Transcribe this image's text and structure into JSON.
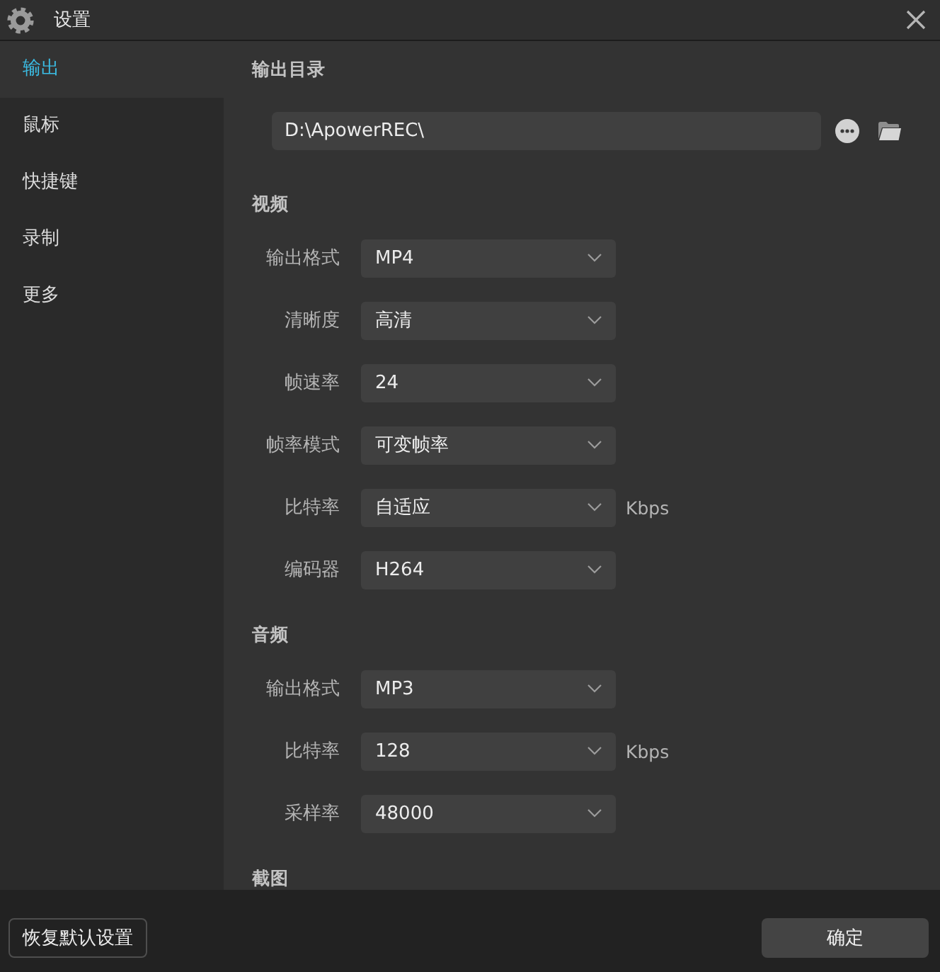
{
  "window": {
    "title": "设置"
  },
  "sidebar": {
    "items": [
      {
        "label": "输出",
        "selected": true
      },
      {
        "label": "鼠标",
        "selected": false
      },
      {
        "label": "快捷键",
        "selected": false
      },
      {
        "label": "录制",
        "selected": false
      },
      {
        "label": "更多",
        "selected": false
      }
    ]
  },
  "output_directory": {
    "heading": "输出目录",
    "path": "D:\\ApowerREC\\"
  },
  "sections": [
    {
      "heading": "视频",
      "fields": [
        {
          "label": "输出格式",
          "value": "MP4"
        },
        {
          "label": "清晰度",
          "value": "高清"
        },
        {
          "label": "帧速率",
          "value": "24"
        },
        {
          "label": "帧率模式",
          "value": "可变帧率"
        },
        {
          "label": "比特率",
          "value": "自适应",
          "unit": "Kbps"
        },
        {
          "label": "编码器",
          "value": "H264"
        }
      ]
    },
    {
      "heading": "音频",
      "fields": [
        {
          "label": "输出格式",
          "value": "MP3"
        },
        {
          "label": "比特率",
          "value": "128",
          "unit": "Kbps"
        },
        {
          "label": "采样率",
          "value": "48000"
        }
      ]
    },
    {
      "heading": "截图"
    }
  ],
  "footer": {
    "buttons": [
      {
        "label": "恢复默认设置",
        "kind": "outline"
      },
      {
        "label": "确定",
        "kind": "primary"
      }
    ]
  }
}
